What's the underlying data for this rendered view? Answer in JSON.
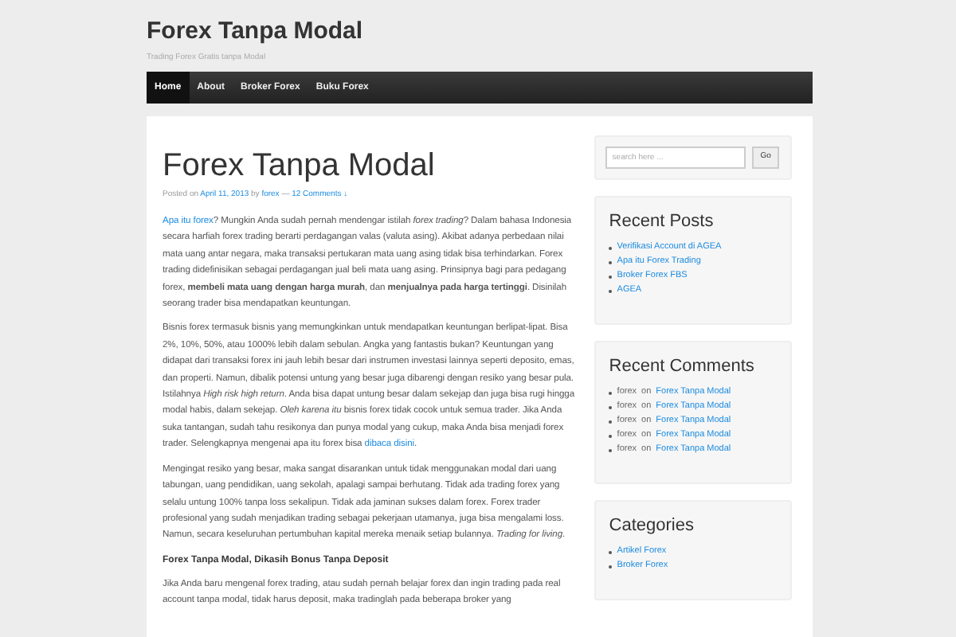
{
  "site": {
    "title": "Forex Tanpa Modal",
    "tagline": "Trading Forex Gratis tanpa Modal"
  },
  "nav": [
    {
      "label": "Home",
      "selected": true
    },
    {
      "label": "About",
      "selected": false
    },
    {
      "label": "Broker Forex",
      "selected": false
    },
    {
      "label": "Buku Forex",
      "selected": false
    }
  ],
  "article": {
    "title": "Forex Tanpa Modal",
    "meta": [
      {
        "kind": "text",
        "text": "Posted on "
      },
      {
        "kind": "link",
        "text": "April 11, 2013"
      },
      {
        "kind": "text",
        "text": " by "
      },
      {
        "kind": "link",
        "text": "forex"
      },
      {
        "kind": "text",
        "text": " — "
      },
      {
        "kind": "link",
        "text": "12 Comments ↓"
      }
    ],
    "blocks": [
      {
        "kind": "paragraph",
        "segments": [
          {
            "kind": "link",
            "text": "Apa itu forex"
          },
          {
            "kind": "text",
            "text": "? Mungkin Anda sudah pernah mendengar istilah *forex trading*? Dalam bahasa Indonesia secara harfiah forex trading berarti perdagangan valas (valuta asing). Akibat adanya perbedaan nilai mata uang antar negara, maka transaksi pertukaran mata uang asing tidak bisa terhindarkan. Forex trading didefinisikan sebagai perdagangan jual beli mata uang asing. Prinsipnya bagi para pedagang forex, **membeli mata uang dengan harga murah**, dan **menjualnya pada harga tertinggi**. Disinilah seorang trader bisa mendapatkan keuntungan."
          }
        ]
      },
      {
        "kind": "paragraph",
        "segments": [
          {
            "kind": "text",
            "text": "Bisnis forex termasuk bisnis yang memungkinkan untuk mendapatkan keuntungan berlipat-lipat. Bisa 2%, 10%, 50%, atau 1000% lebih dalam sebulan. Angka yang fantastis bukan? Keuntungan yang didapat dari transaksi forex ini jauh lebih besar dari instrumen investasi lainnya seperti deposito, emas, dan properti. Namun, dibalik potensi untung yang besar juga dibarengi dengan resiko yang besar pula. Istilahnya *High risk high return*. Anda bisa dapat untung besar dalam sekejap dan juga bisa rugi hingga modal habis, dalam sekejap. *Oleh karena itu* bisnis forex tidak cocok untuk semua trader. Jika Anda suka tantangan, sudah tahu resikonya dan punya modal yang cukup, maka Anda bisa menjadi forex trader. Selengkapnya mengenai apa itu forex bisa "
          },
          {
            "kind": "link",
            "text": "dibaca disini"
          },
          {
            "kind": "text",
            "text": "."
          }
        ]
      },
      {
        "kind": "paragraph",
        "segments": [
          {
            "kind": "text",
            "text": "Mengingat resiko yang besar, maka sangat disarankan untuk tidak menggunakan modal dari uang tabungan, uang pendidikan, uang sekolah, apalagi sampai berhutang. Tidak ada trading forex yang selalu untung 100% tanpa loss sekalipun. Tidak ada jaminan sukses dalam forex. Forex trader profesional yang sudah menjadikan trading sebagai pekerjaan utamanya, juga bisa mengalami loss. Namun, secara keseluruhan pertumbuhan kapital mereka menaik setiap bulannya. *Trading for living*."
          }
        ]
      },
      {
        "kind": "heading",
        "text": "Forex Tanpa Modal, Dikasih Bonus Tanpa Deposit"
      },
      {
        "kind": "paragraph",
        "segments": [
          {
            "kind": "text",
            "text": "Jika Anda baru mengenal forex trading, atau sudah pernah belajar forex dan ingin trading pada real account tanpa modal, tidak harus deposit, maka tradinglah pada beberapa broker yang"
          }
        ]
      }
    ]
  },
  "search": {
    "placeholder": "search here ...",
    "button": "Go"
  },
  "widgets": [
    {
      "title": "Recent Posts",
      "items": [
        {
          "link": "Verifikasi Account di AGEA"
        },
        {
          "link": "Apa itu Forex Trading"
        },
        {
          "link": "Broker Forex FBS"
        },
        {
          "link": "AGEA"
        }
      ]
    },
    {
      "title": "Recent Comments",
      "items": [
        {
          "author": "forex",
          "on": "on",
          "link": "Forex Tanpa Modal"
        },
        {
          "author": "forex",
          "on": "on",
          "link": "Forex Tanpa Modal"
        },
        {
          "author": "forex",
          "on": "on",
          "link": "Forex Tanpa Modal"
        },
        {
          "author": "forex",
          "on": "on",
          "link": "Forex Tanpa Modal"
        },
        {
          "author": "forex",
          "on": "on",
          "link": "Forex Tanpa Modal"
        }
      ]
    },
    {
      "title": "Categories",
      "items": [
        {
          "link": "Artikel Forex"
        },
        {
          "link": "Broker Forex"
        }
      ]
    }
  ]
}
